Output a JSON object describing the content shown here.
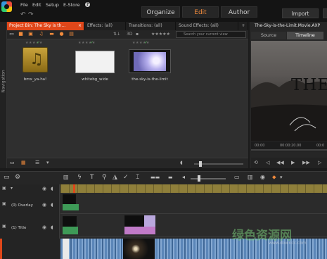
{
  "menu": {
    "items": [
      "File",
      "Edit",
      "Setup",
      "E-Store"
    ],
    "help": "?",
    "undo": "↶",
    "redo": "↷"
  },
  "modes": {
    "organize": "Organize",
    "edit": "Edit",
    "author": "Author",
    "active": "Edit"
  },
  "header": {
    "import": "Import"
  },
  "navigation": {
    "label": "Navigation"
  },
  "library": {
    "tabs": [
      {
        "label": "Project Bin: The Sky is th...",
        "active": true
      },
      {
        "label": "Effects: (all)"
      },
      {
        "label": "Transitions: (all)"
      },
      {
        "label": "Sound Effects: (all)"
      }
    ],
    "search_placeholder": "Search your current view",
    "view_3d": "3D",
    "rating": "★★★★★",
    "assets": [
      {
        "name": "bmx_ya-ha!",
        "kind": "audio",
        "checked": true
      },
      {
        "name": "whitebg_wide",
        "kind": "image",
        "checked": true
      },
      {
        "name": "the-sky-is-the-limit",
        "kind": "video",
        "checked": true
      }
    ]
  },
  "player": {
    "title": "The-Sky-is-the-Limit.Movie.AXP",
    "tabs": [
      "Source",
      "Timeline"
    ],
    "active_tab": "Timeline",
    "preview_text": "THE",
    "timecodes": [
      "00:00",
      "00:00:20.00",
      "00:0"
    ]
  },
  "timeline": {
    "tracks": [
      {
        "label": "(0) Overlay"
      },
      {
        "label": "(1) Title"
      }
    ]
  },
  "watermark": {
    "text": "绿色资源网",
    "url": "www.downcc.com"
  },
  "colors": {
    "accent": "#e0471a",
    "mode_active": "#f08a3c",
    "panel": "#2f2f2f"
  }
}
